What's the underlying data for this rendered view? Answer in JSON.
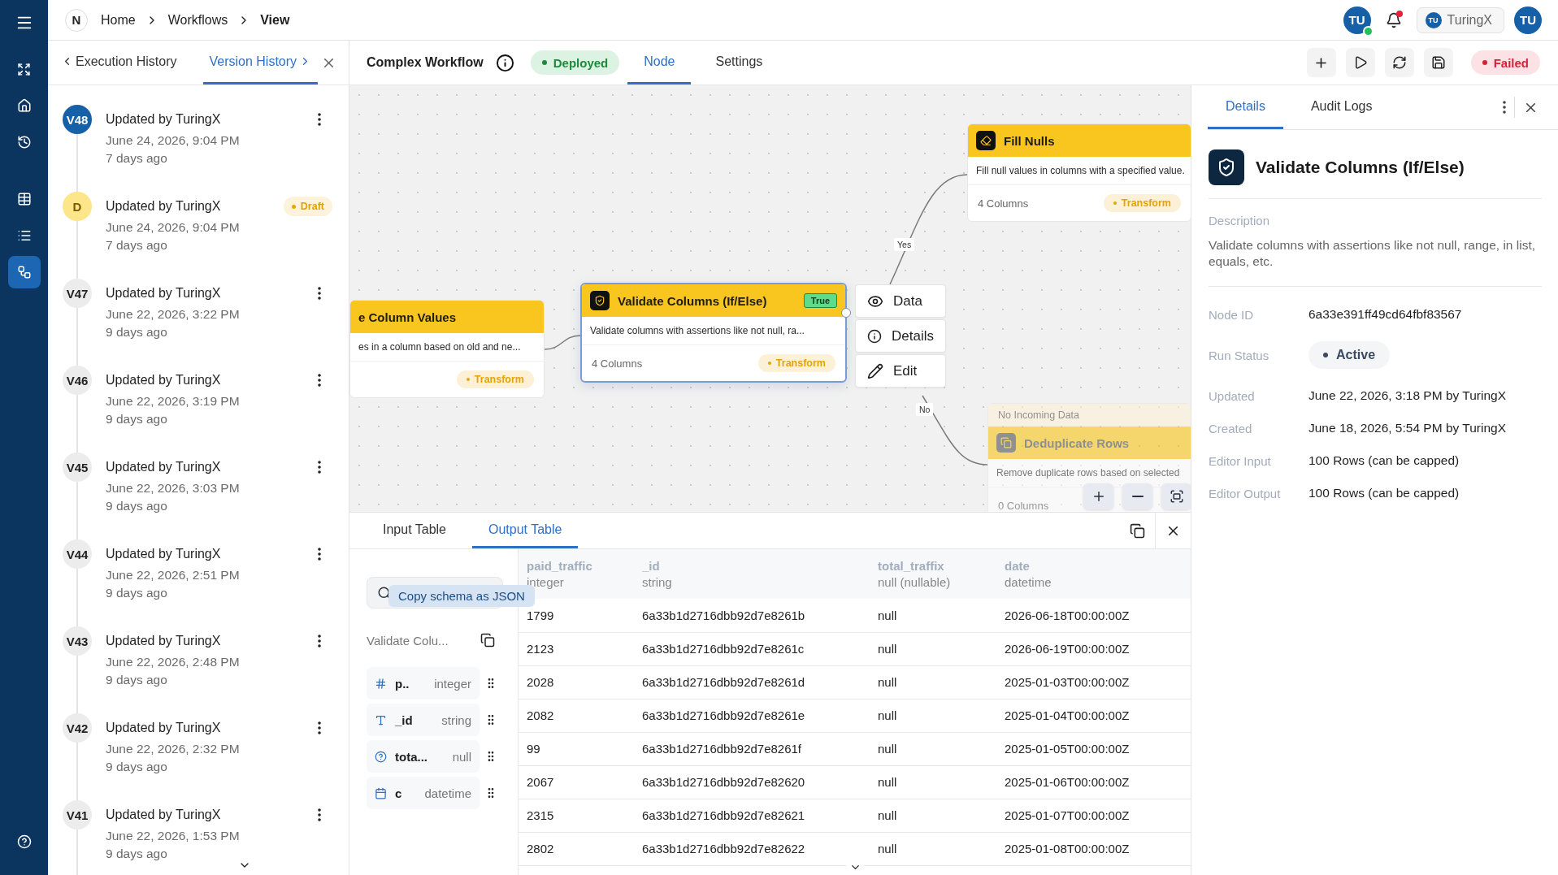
{
  "brand": {
    "logo": "N"
  },
  "nav_items": [
    {
      "kind": "menu",
      "selected": false
    },
    {
      "kind": "expand",
      "selected": false
    },
    {
      "kind": "home",
      "selected": false
    },
    {
      "kind": "history",
      "selected": false
    },
    {
      "kind": "table",
      "selected": false
    },
    {
      "kind": "list",
      "selected": false
    },
    {
      "kind": "workflow",
      "selected": true
    },
    {
      "kind": "help",
      "selected": false
    }
  ],
  "breadcrumb": [
    "Home",
    "Workflows",
    "View"
  ],
  "top_right": {
    "presence": {
      "initials": "TU",
      "online": true
    },
    "notifications": {
      "unread": true
    },
    "workspace": {
      "initials": "TU",
      "name": "TuringX"
    },
    "user": {
      "initials": "TU"
    }
  },
  "history_panel": {
    "tabs": [
      {
        "label": "Execution History",
        "selected": false
      },
      {
        "label": "Version History",
        "selected": true
      }
    ],
    "versions": [
      {
        "kind": "current",
        "badge": "V48",
        "title": "Updated by TuringX",
        "date": "June 24, 2026, 9:04 PM",
        "ago": "7 days ago"
      },
      {
        "kind": "draft",
        "badge": "D",
        "title": "Updated by TuringX",
        "date": "June 24, 2026, 9:04 PM",
        "ago": "7 days ago",
        "tag": "Draft"
      },
      {
        "kind": "version",
        "badge": "V47",
        "title": "Updated by TuringX",
        "date": "June 22, 2026, 3:22 PM",
        "ago": "9 days ago"
      },
      {
        "kind": "version",
        "badge": "V46",
        "title": "Updated by TuringX",
        "date": "June 22, 2026, 3:19 PM",
        "ago": "9 days ago"
      },
      {
        "kind": "version",
        "badge": "V45",
        "title": "Updated by TuringX",
        "date": "June 22, 2026, 3:03 PM",
        "ago": "9 days ago"
      },
      {
        "kind": "version",
        "badge": "V44",
        "title": "Updated by TuringX",
        "date": "June 22, 2026, 2:51 PM",
        "ago": "9 days ago"
      },
      {
        "kind": "version",
        "badge": "V43",
        "title": "Updated by TuringX",
        "date": "June 22, 2026, 2:48 PM",
        "ago": "9 days ago"
      },
      {
        "kind": "version",
        "badge": "V42",
        "title": "Updated by TuringX",
        "date": "June 22, 2026, 2:32 PM",
        "ago": "9 days ago"
      },
      {
        "kind": "version",
        "badge": "V41",
        "title": "Updated by TuringX",
        "date": "June 22, 2026, 1:53 PM",
        "ago": "9 days ago"
      }
    ]
  },
  "workflow_header": {
    "title": "Complex Workflow",
    "status": {
      "kind": "success",
      "label": "Deployed"
    },
    "tabs": [
      {
        "label": "Node",
        "selected": true
      },
      {
        "label": "Settings",
        "selected": false
      }
    ],
    "run_status": {
      "kind": "error",
      "label": "Failed"
    }
  },
  "canvas": {
    "nodes": [
      {
        "kind": "replace",
        "title": "e Column Values",
        "description": "es in a column based on old and ne...",
        "tag": "Transform",
        "selected": false,
        "disabled": false
      },
      {
        "kind": "validate",
        "title": "Validate Columns (If/Else)",
        "badge": "True",
        "description": "Validate columns with assertions like not null, ra...",
        "columns": "4 Columns",
        "tag": "Transform",
        "selected": true,
        "disabled": false
      },
      {
        "kind": "fill",
        "title": "Fill Nulls",
        "description": "Fill null values in columns with a specified value.",
        "columns": "4 Columns",
        "tag": "Transform",
        "selected": false,
        "disabled": false
      },
      {
        "kind": "dedupe",
        "notice": "No Incoming Data",
        "title": "Deduplicate Rows",
        "description": "Remove duplicate rows based on selected",
        "columns": "0 Columns",
        "selected": false,
        "disabled": true
      }
    ],
    "edges": [
      {
        "label": "Yes"
      },
      {
        "label": "No"
      }
    ],
    "node_menu": [
      {
        "kind": "view",
        "label": "Data"
      },
      {
        "kind": "info",
        "label": "Details"
      },
      {
        "kind": "edit",
        "label": "Edit"
      }
    ]
  },
  "data_panel": {
    "tabs": [
      {
        "label": "Input Table",
        "selected": false
      },
      {
        "label": "Output Table",
        "selected": true
      }
    ],
    "tooltip": "Copy schema as JSON",
    "source": "Validate Colu...",
    "schema": [
      {
        "kind": "number",
        "name": "p..",
        "type": "integer"
      },
      {
        "kind": "text",
        "name": "_id",
        "type": "string"
      },
      {
        "kind": "unknown",
        "name": "tota...",
        "type": "null"
      },
      {
        "kind": "date",
        "name": "c",
        "type": "datetime"
      }
    ],
    "table": {
      "columns": [
        {
          "name": "paid_traffic",
          "type": "integer"
        },
        {
          "name": "_id",
          "type": "string"
        },
        {
          "name": "total_traffix",
          "type": "null (nullable)"
        },
        {
          "name": "date",
          "type": "datetime"
        }
      ],
      "rows": [
        [
          "1799",
          "6a33b1d2716dbb92d7e8261b",
          "null",
          "2026-06-18T00:00:00Z"
        ],
        [
          "2123",
          "6a33b1d2716dbb92d7e8261c",
          "null",
          "2026-06-19T00:00:00Z"
        ],
        [
          "2028",
          "6a33b1d2716dbb92d7e8261d",
          "null",
          "2025-01-03T00:00:00Z"
        ],
        [
          "2082",
          "6a33b1d2716dbb92d7e8261e",
          "null",
          "2025-01-04T00:00:00Z"
        ],
        [
          "99",
          "6a33b1d2716dbb92d7e8261f",
          "null",
          "2025-01-05T00:00:00Z"
        ],
        [
          "2067",
          "6a33b1d2716dbb92d7e82620",
          "null",
          "2025-01-06T00:00:00Z"
        ],
        [
          "2315",
          "6a33b1d2716dbb92d7e82621",
          "null",
          "2025-01-07T00:00:00Z"
        ],
        [
          "2802",
          "6a33b1d2716dbb92d7e82622",
          "null",
          "2025-01-08T00:00:00Z"
        ]
      ]
    }
  },
  "details_panel": {
    "tabs": [
      {
        "label": "Details",
        "selected": true
      },
      {
        "label": "Audit Logs",
        "selected": false
      }
    ],
    "title": "Validate Columns (If/Else)",
    "description_label": "Description",
    "description": "Validate columns with assertions like not null, range, in list, equals, etc.",
    "fields": [
      {
        "kind": "text",
        "label": "Node ID",
        "value": "6a33e391ff49cd64fbf83567"
      },
      {
        "kind": "status",
        "label": "Run Status",
        "value": "Active"
      },
      {
        "kind": "text",
        "label": "Updated",
        "value": "June 22, 2026, 3:18 PM by TuringX"
      },
      {
        "kind": "text",
        "label": "Created",
        "value": "June 18, 2026, 5:54 PM by TuringX"
      },
      {
        "kind": "text",
        "label": "Editor Input",
        "value": "100 Rows (can be capped)"
      },
      {
        "kind": "text",
        "label": "Editor Output",
        "value": "100 Rows (can be capped)"
      }
    ]
  }
}
